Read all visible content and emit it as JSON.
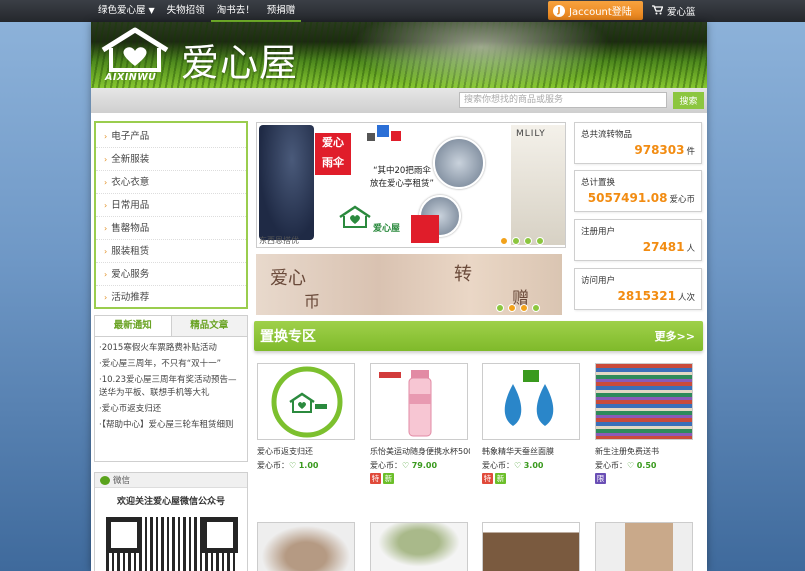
{
  "topnav": {
    "items": [
      {
        "label": "绿色爱心屋",
        "has_dropdown": true,
        "active": false
      },
      {
        "label": "失物招领",
        "active": false
      },
      {
        "label": "淘书去！",
        "active": true
      },
      {
        "label": "预捐赠",
        "active": true
      }
    ],
    "login_label": "Jaccount登陆",
    "cart_label": "爱心篮"
  },
  "banner": {
    "logo_text": "AIXINWU",
    "site_name": "爱心屋"
  },
  "search": {
    "placeholder": "搜索你想找的商品或服务",
    "button_label": "搜索"
  },
  "categories": [
    "电子产品",
    "全新服装",
    "衣心衣意",
    "日常用品",
    "售罄物品",
    "服装租赁",
    "爱心服务",
    "活动推荐"
  ],
  "news": {
    "tabs": [
      "最新通知",
      "精品文章"
    ],
    "items": [
      "·2015寒假火车票路费补贴活动",
      "·爱心屋三周年，不只有“双十一”",
      "·10.23爱心屋三周年有奖活动预告—送华为平板、联想手机等大礼",
      "·爱心币返支归还",
      "·【帮助中心】爱心屋三轮车租赁细则"
    ]
  },
  "wechat": {
    "head": "微信",
    "title": "欢迎关注爱心屋微信公众号"
  },
  "slides": {
    "umbrella_label_1": "爱心",
    "umbrella_label_2": "雨伞",
    "quote_1": "“其中20把雨伞",
    "quote_2": "放在爱心亭租赁”",
    "logo_text": "爱心屋",
    "brand": "MLILY",
    "footer_text": "东西恩搭优",
    "banner2_text_1": "爱心",
    "banner2_text_2": "币",
    "banner2_text_3": "转",
    "banner2_text_4": "赠"
  },
  "stats": [
    {
      "label": "总共流转物品",
      "value": "978303",
      "unit": "件"
    },
    {
      "label": "总计置换",
      "value": "5057491.08",
      "unit": "爱心币"
    },
    {
      "label": "注册用户",
      "value": "27481",
      "unit": "人"
    },
    {
      "label": "访问用户",
      "value": "2815321",
      "unit": "人次"
    }
  ],
  "section": {
    "title": "置换专区",
    "more": "更多>>"
  },
  "products": [
    {
      "name": "爱心币返支归还",
      "price_prefix": "爱心币：",
      "price": "1.00",
      "tags": []
    },
    {
      "name": "乐怡美运动随身便携水杯500",
      "price_prefix": "爱心币：",
      "price": "79.00",
      "tags": [
        "特",
        "新"
      ]
    },
    {
      "name": "韩象精华天蚕丝面膜",
      "price_prefix": "爱心币：",
      "price": "3.00",
      "tags": [
        "特",
        "新"
      ]
    },
    {
      "name": "新生注册免费送书",
      "price_prefix": "爱心币：",
      "price": "0.50",
      "tags": [
        "限"
      ]
    }
  ],
  "colors": {
    "accent_green": "#8cc63f",
    "stat_orange": "#f28c12",
    "login_orange": "#f7a23e"
  }
}
